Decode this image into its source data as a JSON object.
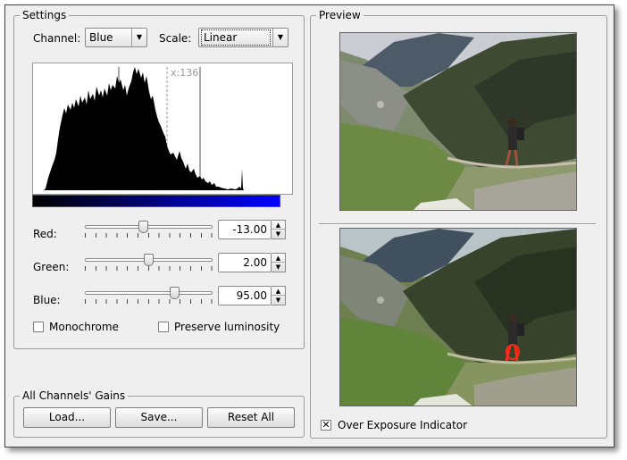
{
  "settings": {
    "title": "Settings",
    "channel_label": "Channel:",
    "channel_value": "Blue",
    "scale_label": "Scale:",
    "scale_value": "Linear",
    "cursor_readout": "x:136",
    "red": {
      "label": "Red:",
      "value": "-13.00",
      "level": 0.45
    },
    "green": {
      "label": "Green:",
      "value": "2.00",
      "level": 0.49
    },
    "blue": {
      "label": "Blue:",
      "value": "95.00",
      "level": 0.71
    },
    "monochrome_label": "Monochrome",
    "monochrome_checked": false,
    "preserve_luminosity_label": "Preserve luminosity",
    "preserve_luminosity_checked": false
  },
  "gains": {
    "title": "All Channels' Gains",
    "load_label": "Load...",
    "save_label": "Save...",
    "reset_label": "Reset All"
  },
  "preview": {
    "title": "Preview",
    "over_exposure_label": "Over Exposure Indicator",
    "over_exposure_checked": true
  },
  "colors": {
    "gradient_start": "#000000",
    "gradient_end": "#0000ff",
    "overexposure_marker": "#ff2a1a"
  },
  "icons": [
    "chevron-down-icon",
    "spin-up-icon",
    "spin-down-icon",
    "checkmark-icon"
  ]
}
